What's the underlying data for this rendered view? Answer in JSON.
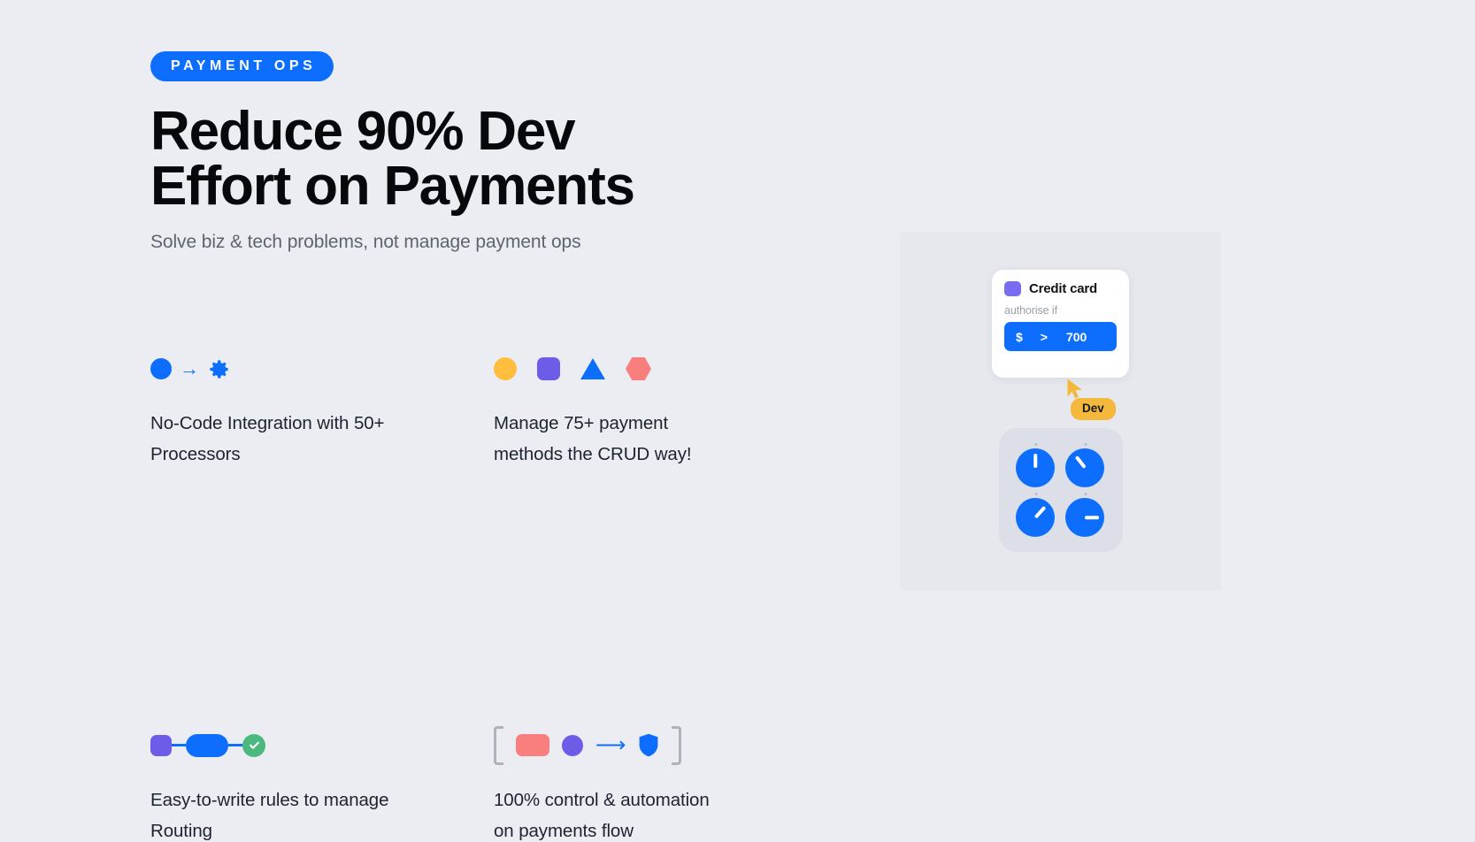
{
  "hero": {
    "eyebrow": "PAYMENT OPS",
    "headline_line1": "Reduce 90% Dev",
    "headline_line2": "Effort on Payments",
    "subhead": "Solve biz & tech problems, not manage payment ops"
  },
  "features": [
    {
      "id": "no-code-integration",
      "text": "No-Code Integration with 50+ Processors",
      "icon": "circle-arrow-gear-icon"
    },
    {
      "id": "payment-methods",
      "text": "Manage 75+ payment methods the CRUD way!",
      "icon": "four-shapes-icon"
    },
    {
      "id": "routing-rules",
      "text": "Easy-to-write rules to manage Routing",
      "icon": "square-pill-check-icon"
    },
    {
      "id": "control-automation",
      "text": "100% control & automation on payments flow",
      "icon": "bracket-flow-icon"
    }
  ],
  "illustration": {
    "rule_card": {
      "title": "Credit card",
      "subtitle": "authorise if",
      "condition_currency": "$",
      "condition_operator": ">",
      "condition_value": "700"
    },
    "cursor_label": "Dev",
    "knobs": [
      {
        "name": "knob-1",
        "angle": 0
      },
      {
        "name": "knob-2",
        "angle": -38
      },
      {
        "name": "knob-3",
        "angle": 42
      },
      {
        "name": "knob-4",
        "angle": 90
      }
    ]
  },
  "colors": {
    "background": "#ebedf2",
    "accent_blue": "#0d6efd",
    "purple": "#6c5ce7",
    "yellow": "#ffbe3d",
    "salmon": "#f97f7f",
    "green": "#4bb97d",
    "amber": "#f4b93c"
  }
}
